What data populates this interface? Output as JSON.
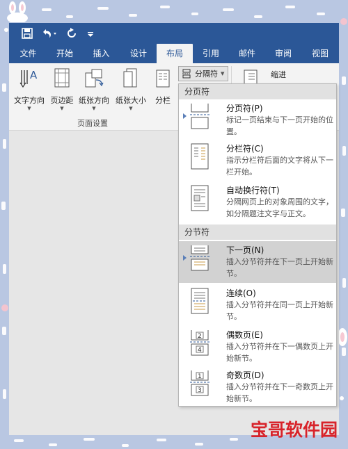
{
  "quick_access": {
    "save_icon": "save-icon",
    "undo_icon": "undo-icon",
    "redo_icon": "redo-icon",
    "customize_icon": "customize-icon"
  },
  "tabs": [
    {
      "label": "文件"
    },
    {
      "label": "开始"
    },
    {
      "label": "插入"
    },
    {
      "label": "设计"
    },
    {
      "label": "布局",
      "active": true
    },
    {
      "label": "引用"
    },
    {
      "label": "邮件"
    },
    {
      "label": "审阅"
    },
    {
      "label": "视图"
    }
  ],
  "ribbon": {
    "buttons": [
      {
        "label": "文字方向"
      },
      {
        "label": "页边距"
      },
      {
        "label": "纸张方向"
      },
      {
        "label": "纸张大小"
      },
      {
        "label": "分栏"
      }
    ],
    "group_label": "页面设置",
    "breaks_button": "分隔符",
    "indent_label": "缩进"
  },
  "menu": {
    "page_breaks_header": "分页符",
    "section_breaks_header": "分节符",
    "items": [
      {
        "title": "分页符(P)",
        "desc": "标记一页结束与下一页开始的位置。",
        "icon": "page-break-icon"
      },
      {
        "title": "分栏符(C)",
        "desc": "指示分栏符后面的文字将从下一栏开始。",
        "icon": "column-break-icon"
      },
      {
        "title": "自动换行符(T)",
        "desc": "分隔网页上的对象周围的文字，如分隔题注文字与正文。",
        "icon": "text-wrapping-break-icon"
      },
      {
        "title": "下一页(N)",
        "desc": "插入分节符并在下一页上开始新节。",
        "icon": "next-page-icon",
        "highlighted": true
      },
      {
        "title": "连续(O)",
        "desc": "插入分节符并在同一页上开始新节。",
        "icon": "continuous-icon"
      },
      {
        "title": "偶数页(E)",
        "desc": "插入分节符并在下一偶数页上开始新节。",
        "icon": "even-page-icon",
        "digits": [
          "2",
          "4"
        ]
      },
      {
        "title": "奇数页(D)",
        "desc": "插入分节符并在下一奇数页上开始新节。",
        "icon": "odd-page-icon",
        "digits": [
          "1",
          "3"
        ]
      }
    ]
  },
  "watermark": "宝哥软件园"
}
